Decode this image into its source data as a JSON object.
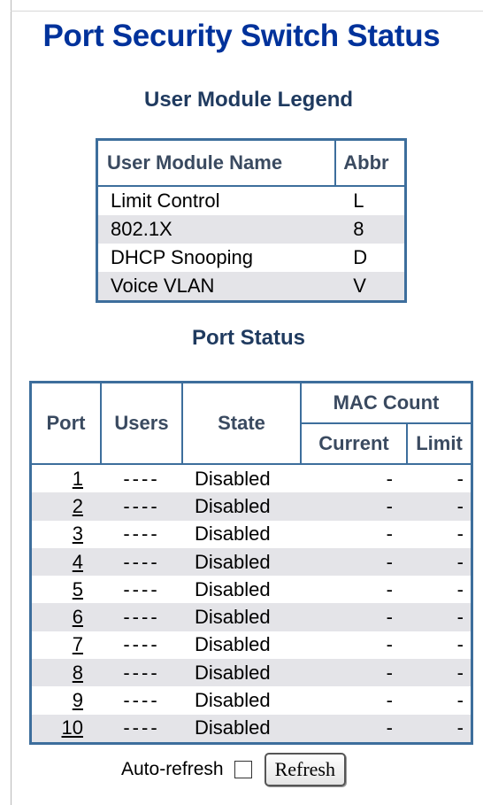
{
  "page": {
    "title": "Port Security Switch Status"
  },
  "legend": {
    "title": "User Module Legend",
    "headers": [
      "User Module Name",
      "Abbr"
    ],
    "rows": [
      {
        "name": "Limit Control",
        "abbr": "L"
      },
      {
        "name": "802.1X",
        "abbr": "8"
      },
      {
        "name": "DHCP Snooping",
        "abbr": "D"
      },
      {
        "name": "Voice VLAN",
        "abbr": "V"
      }
    ]
  },
  "port_status": {
    "title": "Port Status",
    "headers": {
      "port": "Port",
      "users": "Users",
      "state": "State",
      "mac_count": "MAC Count",
      "current": "Current",
      "limit": "Limit"
    },
    "rows": [
      {
        "port": "1",
        "users": "----",
        "state": "Disabled",
        "current": "-",
        "limit": "-"
      },
      {
        "port": "2",
        "users": "----",
        "state": "Disabled",
        "current": "-",
        "limit": "-"
      },
      {
        "port": "3",
        "users": "----",
        "state": "Disabled",
        "current": "-",
        "limit": "-"
      },
      {
        "port": "4",
        "users": "----",
        "state": "Disabled",
        "current": "-",
        "limit": "-"
      },
      {
        "port": "5",
        "users": "----",
        "state": "Disabled",
        "current": "-",
        "limit": "-"
      },
      {
        "port": "6",
        "users": "----",
        "state": "Disabled",
        "current": "-",
        "limit": "-"
      },
      {
        "port": "7",
        "users": "----",
        "state": "Disabled",
        "current": "-",
        "limit": "-"
      },
      {
        "port": "8",
        "users": "----",
        "state": "Disabled",
        "current": "-",
        "limit": "-"
      },
      {
        "port": "9",
        "users": "----",
        "state": "Disabled",
        "current": "-",
        "limit": "-"
      },
      {
        "port": "10",
        "users": "----",
        "state": "Disabled",
        "current": "-",
        "limit": "-"
      }
    ]
  },
  "footer": {
    "auto_refresh_label": "Auto-refresh",
    "auto_refresh_checked": false,
    "refresh_label": "Refresh"
  },
  "colors": {
    "title": "#00329b",
    "table_border": "#3d6e9c",
    "alt_row": "#e4e4e8"
  }
}
